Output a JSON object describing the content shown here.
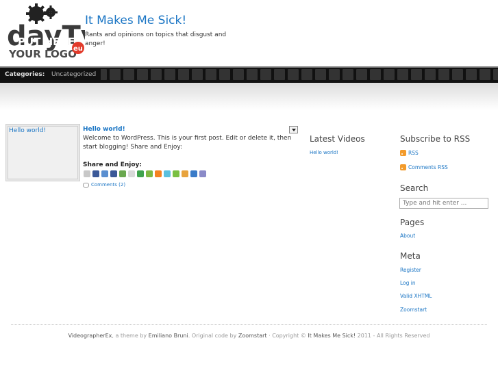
{
  "header": {
    "logo_text_top": "dayTv",
    "logo_text_mid": "PUT HERE",
    "logo_text_bottom": "YOUR LOGO",
    "logo_badge": "eu",
    "site_title": "It Makes Me Sick!",
    "site_description": "Rants and opinions on topics that disgust and anger!"
  },
  "category_bar": {
    "label": "Categories:",
    "items": [
      "Uncategorized"
    ]
  },
  "post": {
    "thumbnail_title": "Hello world!",
    "title": "Hello world!",
    "body": "Welcome to WordPress. This is your first post. Edit or delete it, then start blogging! Share and Enjoy:",
    "share_heading": "Share and Enjoy:",
    "share_icons": [
      "print-icon",
      "digg-icon",
      "delicious-icon",
      "facebook-icon",
      "mixx-icon",
      "google-bookmarks-icon",
      "stumbleupon-icon",
      "technorati-icon",
      "blogger-icon",
      "twitter-icon",
      "yahoo-buzz-icon",
      "design-float-icon",
      "linkedin-icon",
      "email-icon"
    ],
    "share_colors": [
      "#c8c8c8",
      "#3b5998",
      "#5a8fd0",
      "#3b5998",
      "#6aa84f",
      "#d9d9d9",
      "#3fa34d",
      "#7fb842",
      "#f58220",
      "#5bc0de",
      "#7ac043",
      "#e8a33d",
      "#3a7bc8",
      "#8a8ac8"
    ],
    "comments_label": "Comments (2)"
  },
  "latest_videos": {
    "heading": "Latest Videos",
    "items": [
      "Hello world!"
    ]
  },
  "sidebar": {
    "subscribe_heading": "Subscribe to RSS",
    "rss_label": "RSS",
    "comments_rss_label": "Comments RSS",
    "search_heading": "Search",
    "search_placeholder": "Type and hit enter ...",
    "pages_heading": "Pages",
    "pages": [
      "About"
    ],
    "meta_heading": "Meta",
    "meta": [
      "Register",
      "Log in",
      "Valid XHTML",
      "Zoomstart"
    ]
  },
  "footer": {
    "theme_name": "VideographerEx",
    "by_text": ", a theme by ",
    "author": "Emiliano Bruni",
    "original_text": ". Original code by ",
    "original_author": "Zoomstart",
    "copyright_text": " · Copyright © ",
    "site_name": "It Makes Me Sick!",
    "rights_text": " 2011 - All Rights Reserved"
  },
  "colors": {
    "link": "#1a75c4",
    "category_bar": "#111111",
    "rss": "#f39b2b"
  }
}
